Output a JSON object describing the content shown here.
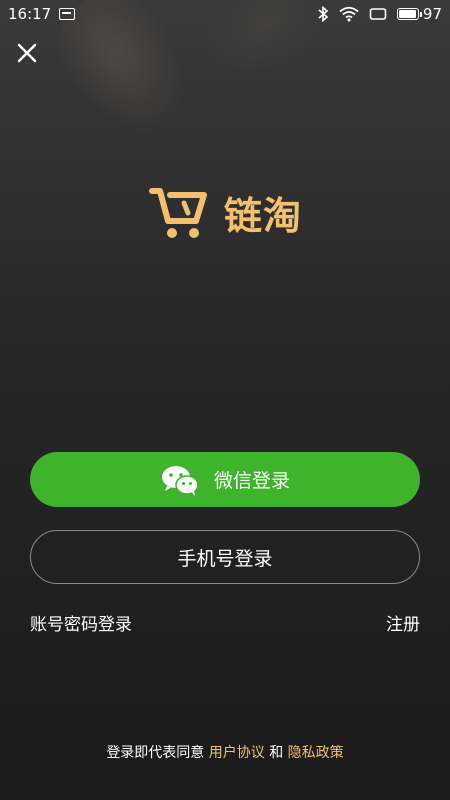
{
  "status_bar": {
    "time": "16:17",
    "battery_level": "97",
    "battery_fraction": 0.97
  },
  "logo": {
    "text": "链淘",
    "color": "#f3c070"
  },
  "buttons": {
    "wechat_label": "微信登录",
    "wechat_color": "#3eb32b",
    "phone_label": "手机号登录"
  },
  "links": {
    "password_login": "账号密码登录",
    "register": "注册"
  },
  "agreement": {
    "prefix": "登录即代表同意",
    "user_agreement": "用户协议",
    "conjunction": "和",
    "privacy_policy": "隐私政策"
  },
  "icons": {
    "close": "close-icon",
    "wechat": "wechat-icon",
    "cart": "cart-logo-icon"
  }
}
